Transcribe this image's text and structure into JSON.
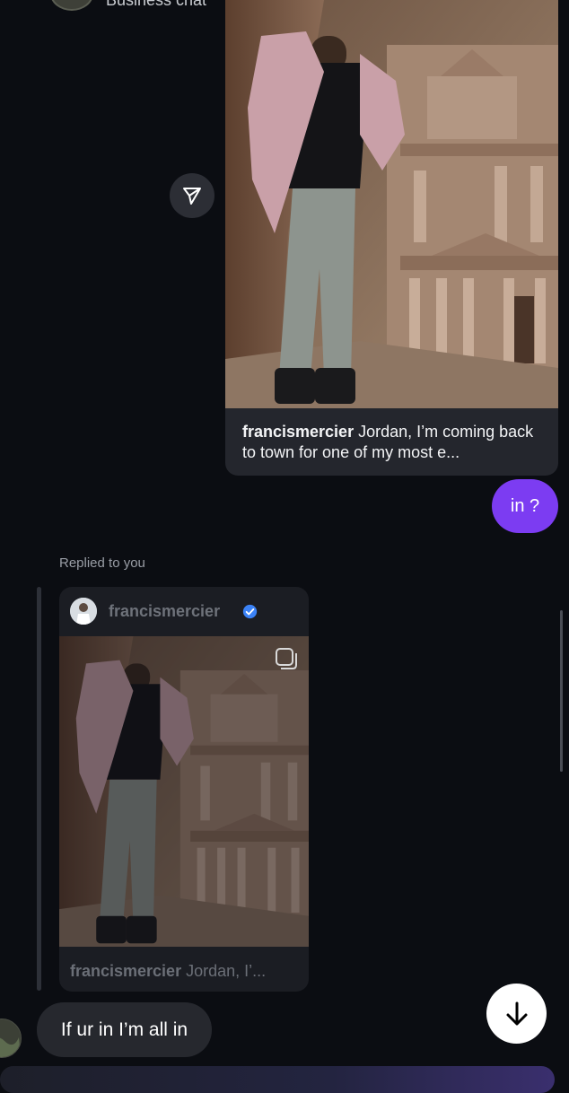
{
  "header": {
    "title": "Business chat"
  },
  "shared_post": {
    "username": "francismercier",
    "caption": "Jordan, I’m coming back to town for one of my most e..."
  },
  "outgoing": {
    "text": "in ?"
  },
  "reply": {
    "label": "Replied to you",
    "username": "francismercier",
    "caption": "Jordan, I’..."
  },
  "incoming": {
    "text": "If ur in I’m all in"
  },
  "colors": {
    "background": "#0b0d12",
    "outgoing_bubble": "#7c3cf2",
    "incoming_bubble": "#26282e",
    "verified_badge": "#3b82f6"
  },
  "icons": {
    "share": "paper-plane-icon",
    "scroll_down": "arrow-down-icon",
    "verified": "verified-badge-icon",
    "multi": "multiple-posts-icon"
  }
}
